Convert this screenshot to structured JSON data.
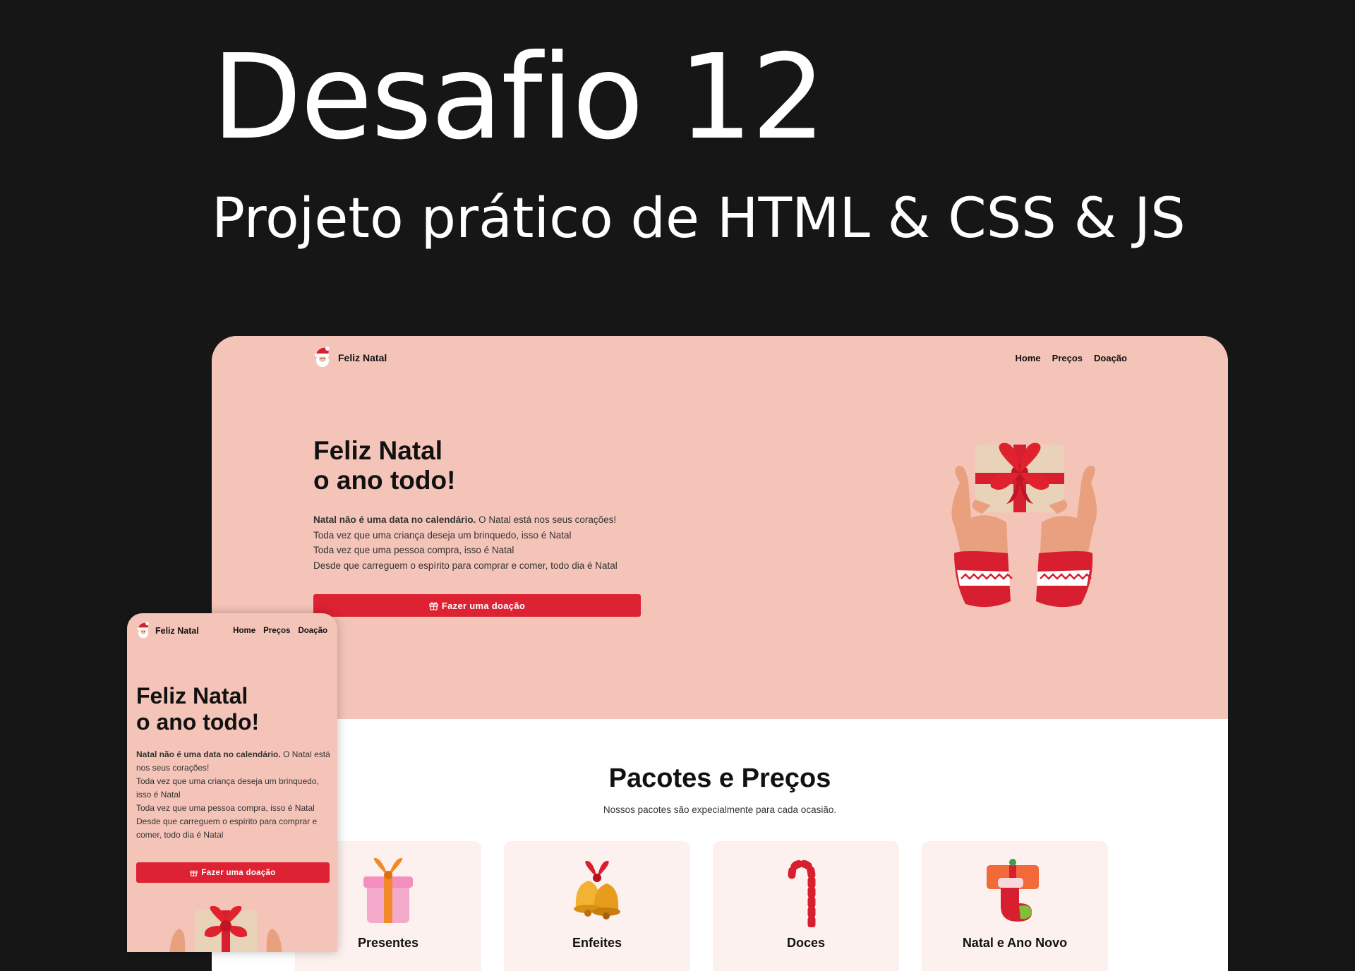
{
  "title": "Desafio 12",
  "subtitle": "Projeto prático de HTML & CSS & JS",
  "desktop": {
    "brand": "Feliz Natal",
    "nav": [
      "Home",
      "Preços",
      "Doação"
    ],
    "hero": {
      "title_line1": "Feliz Natal",
      "title_line2": "o ano todo!",
      "text_bold": "Natal não é uma data no calendário.",
      "text_rest": " O Natal está nos seus corações!",
      "line2": "Toda vez que uma criança deseja um brinquedo, isso é Natal",
      "line3": "Toda vez que uma pessoa compra, isso é Natal",
      "line4": "Desde que carreguem o espírito para comprar e comer, todo dia é Natal",
      "button": "Fazer uma doação"
    },
    "section": {
      "title": "Pacotes e Preços",
      "subtitle": "Nossos pacotes são expecialmente para cada ocasião."
    },
    "cards": [
      {
        "title": "Presentes",
        "icon": "gift-icon"
      },
      {
        "title": "Enfeites",
        "icon": "bells-icon"
      },
      {
        "title": "Doces",
        "icon": "candy-cane-icon"
      },
      {
        "title": "Natal e Ano Novo",
        "icon": "stocking-icon"
      }
    ]
  },
  "mobile": {
    "brand": "Feliz Natal",
    "nav": [
      "Home",
      "Preços",
      "Doação"
    ],
    "title_line1": "Feliz Natal",
    "title_line2": "o ano todo!",
    "text_bold": "Natal não é uma data no calendário.",
    "text_rest": " O Natal está nos seus corações!",
    "line2": "Toda vez que uma criança deseja um brinquedo, isso é Natal",
    "line3": "Toda vez que uma pessoa compra, isso é Natal",
    "line4": "Desde que carreguem o espírito para comprar e comer, todo dia é Natal",
    "button": "Fazer uma doação"
  },
  "colors": {
    "background": "#161616",
    "hero": "#f5c4b8",
    "accent": "#dc2233",
    "card": "#fdf1ef"
  }
}
